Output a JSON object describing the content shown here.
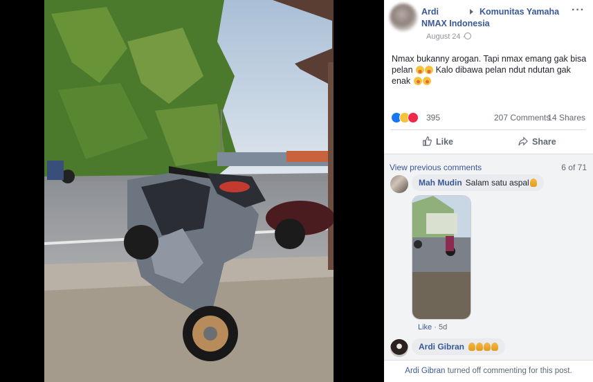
{
  "post": {
    "author": "Ardi",
    "group_line1": "Komunitas Yamaha",
    "group_line2": "NMAX Indonesia",
    "date": "August 24 ·",
    "text_line1": "Nmax bukanny arogan. Tapi nmax emang gak bisa",
    "text_line2a": "pelan",
    "text_line2b": " Kalo dibawa pelan ndut ndutan gak",
    "text_line3": "enak",
    "reaction_count": "395",
    "comments_count": "207 Comments",
    "shares_count": "14 Shares"
  },
  "actions": {
    "like": "Like",
    "share": "Share"
  },
  "comments": {
    "view_previous": "View previous comments",
    "page_of": "6 of 71",
    "items": [
      {
        "name": "Mah Mudin",
        "text": "Salam satu aspal"
      },
      {
        "name": "Ardi Gibran",
        "text": ""
      }
    ],
    "meta_like": "Like",
    "meta_time": "· 5d"
  },
  "footer": {
    "name": "Ardi Gibran",
    "text": " turned off commenting for this post."
  },
  "colors": {
    "link": "#385898",
    "secondary": "#606770",
    "reaction_like": "#1877f2",
    "reaction_love": "#f02849",
    "reaction_haha": "#f7c23b"
  },
  "icons": [
    "globe-icon",
    "more-options-icon",
    "thumbs-up-icon",
    "share-arrow-icon",
    "folded-hands-emoji"
  ]
}
